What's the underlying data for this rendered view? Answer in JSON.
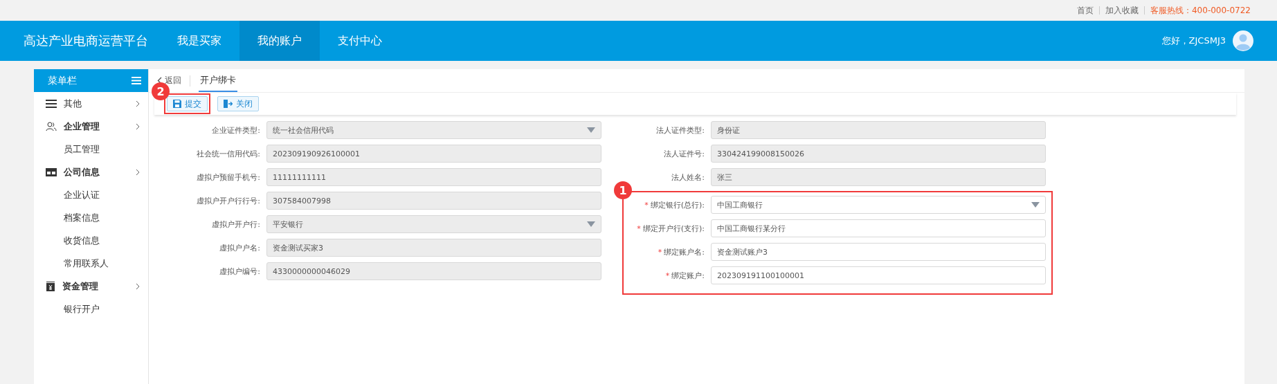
{
  "top_links": [
    {
      "kind": "link",
      "text": "首页"
    },
    {
      "kind": "link",
      "text": "加入收藏"
    },
    {
      "kind": "hotline",
      "text": "客服热线：400-000-0722"
    }
  ],
  "nav": {
    "brand": "高达产业电商运营平台",
    "items": [
      {
        "label": "我是买家",
        "selected": false
      },
      {
        "label": "我的账户",
        "selected": true
      },
      {
        "label": "支付中心",
        "selected": false
      }
    ],
    "greeting": "您好，ZJCSMJ3"
  },
  "sidebar": {
    "title": "菜单栏",
    "items": [
      {
        "kind": "menu",
        "label": "其他"
      },
      {
        "kind": "group",
        "label": "企业管理"
      },
      {
        "kind": "link",
        "label": "员工管理"
      },
      {
        "kind": "group",
        "label": "公司信息"
      },
      {
        "kind": "link",
        "label": "企业认证"
      },
      {
        "kind": "link",
        "label": "档案信息"
      },
      {
        "kind": "link",
        "label": "收货信息"
      },
      {
        "kind": "link",
        "label": "常用联系人"
      },
      {
        "kind": "group",
        "label": "资金管理"
      },
      {
        "kind": "link",
        "label": "银行开户"
      }
    ]
  },
  "tabs": {
    "back": "返回",
    "items": [
      {
        "label": "开户绑卡",
        "selected": true
      }
    ]
  },
  "toolbar": [
    {
      "kind": "save",
      "label": "提交",
      "badge": "2"
    },
    {
      "kind": "close",
      "label": "关闭"
    }
  ],
  "form": {
    "left": [
      {
        "kind": "select",
        "label": "企业证件类型:",
        "value": "统一社会信用代码",
        "disabled": true
      },
      {
        "label": "社会统一信用代码:",
        "value": "202309190926100001",
        "disabled": true
      },
      {
        "label": "虚拟户预留手机号:",
        "value": "11111111111",
        "disabled": true
      },
      {
        "label": "虚拟户开户行行号:",
        "value": "307584007998",
        "disabled": true
      },
      {
        "kind": "select",
        "label": "虚拟户开户行:",
        "value": "平安银行",
        "disabled": true
      },
      {
        "label": "虚拟户户名:",
        "value": "资金测试买家3",
        "disabled": true
      },
      {
        "label": "虚拟户编号:",
        "value": "4330000000046029",
        "disabled": true
      }
    ],
    "right": [
      {
        "label": "法人证件类型:",
        "value": "身份证",
        "disabled": true
      },
      {
        "label": "法人证件号:",
        "value": "330424199008150026",
        "disabled": true
      },
      {
        "label": "法人姓名:",
        "value": "张三",
        "disabled": true
      }
    ],
    "bank_badge": "1",
    "bank": [
      {
        "kind": "select",
        "required_mark": "*",
        "label": "绑定银行(总行):",
        "value": "中国工商银行",
        "disabled": false
      },
      {
        "required_mark": "*",
        "label": "绑定开户行(支行):",
        "value": "中国工商银行某分行",
        "disabled": false
      },
      {
        "required_mark": "*",
        "label": "绑定账户名:",
        "value": "资金测试账户3",
        "disabled": false
      },
      {
        "required_mark": "*",
        "label": "绑定账户:",
        "value": "202309191100100001",
        "disabled": false
      }
    ]
  }
}
